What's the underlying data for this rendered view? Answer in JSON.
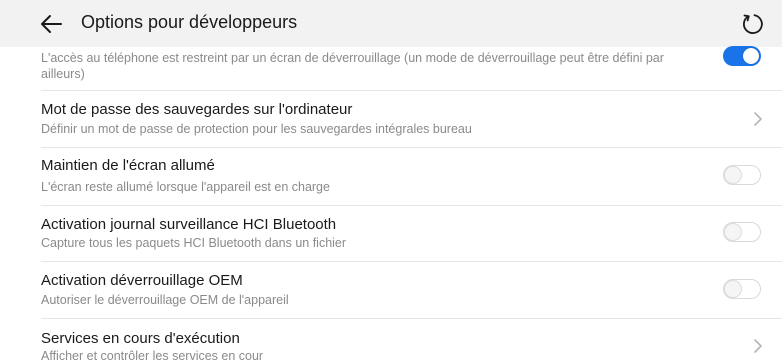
{
  "header": {
    "title": "Options pour développeurs",
    "back_icon": "back-arrow-icon",
    "refresh_icon": "refresh-icon"
  },
  "rows": [
    {
      "subtitle_line1": "L'accès au téléphone est restreint par un écran de déverrouillage (un mode de déverrouillage peut être défini par",
      "subtitle_line2": "ailleurs)",
      "toggle": "on"
    },
    {
      "title": "Mot de passe des sauvegardes sur l'ordinateur",
      "subtitle": "Définir un mot de passe de protection pour les sauvegardes intégrales bureau",
      "control": "chevron-right-icon"
    },
    {
      "title": "Maintien de l'écran allumé",
      "subtitle": "L'écran reste allumé lorsque l'appareil est en charge",
      "toggle": "off"
    },
    {
      "title": "Activation journal surveillance HCI Bluetooth",
      "subtitle": "Capture tous les paquets HCI Bluetooth dans un fichier",
      "toggle": "off"
    },
    {
      "title": "Activation déverrouillage OEM",
      "subtitle": "Autoriser le déverrouillage OEM de l'appareil",
      "toggle": "off"
    },
    {
      "title": "Services en cours d'exécution",
      "subtitle": "Afficher et contrôler les services en cour",
      "control": "chevron-right-icon"
    }
  ],
  "colors": {
    "accent": "#1a73e8",
    "appbar_bg": "#f2f2f2",
    "title_text": "#1a1a1a",
    "subtitle_text": "#8a8a8a"
  }
}
